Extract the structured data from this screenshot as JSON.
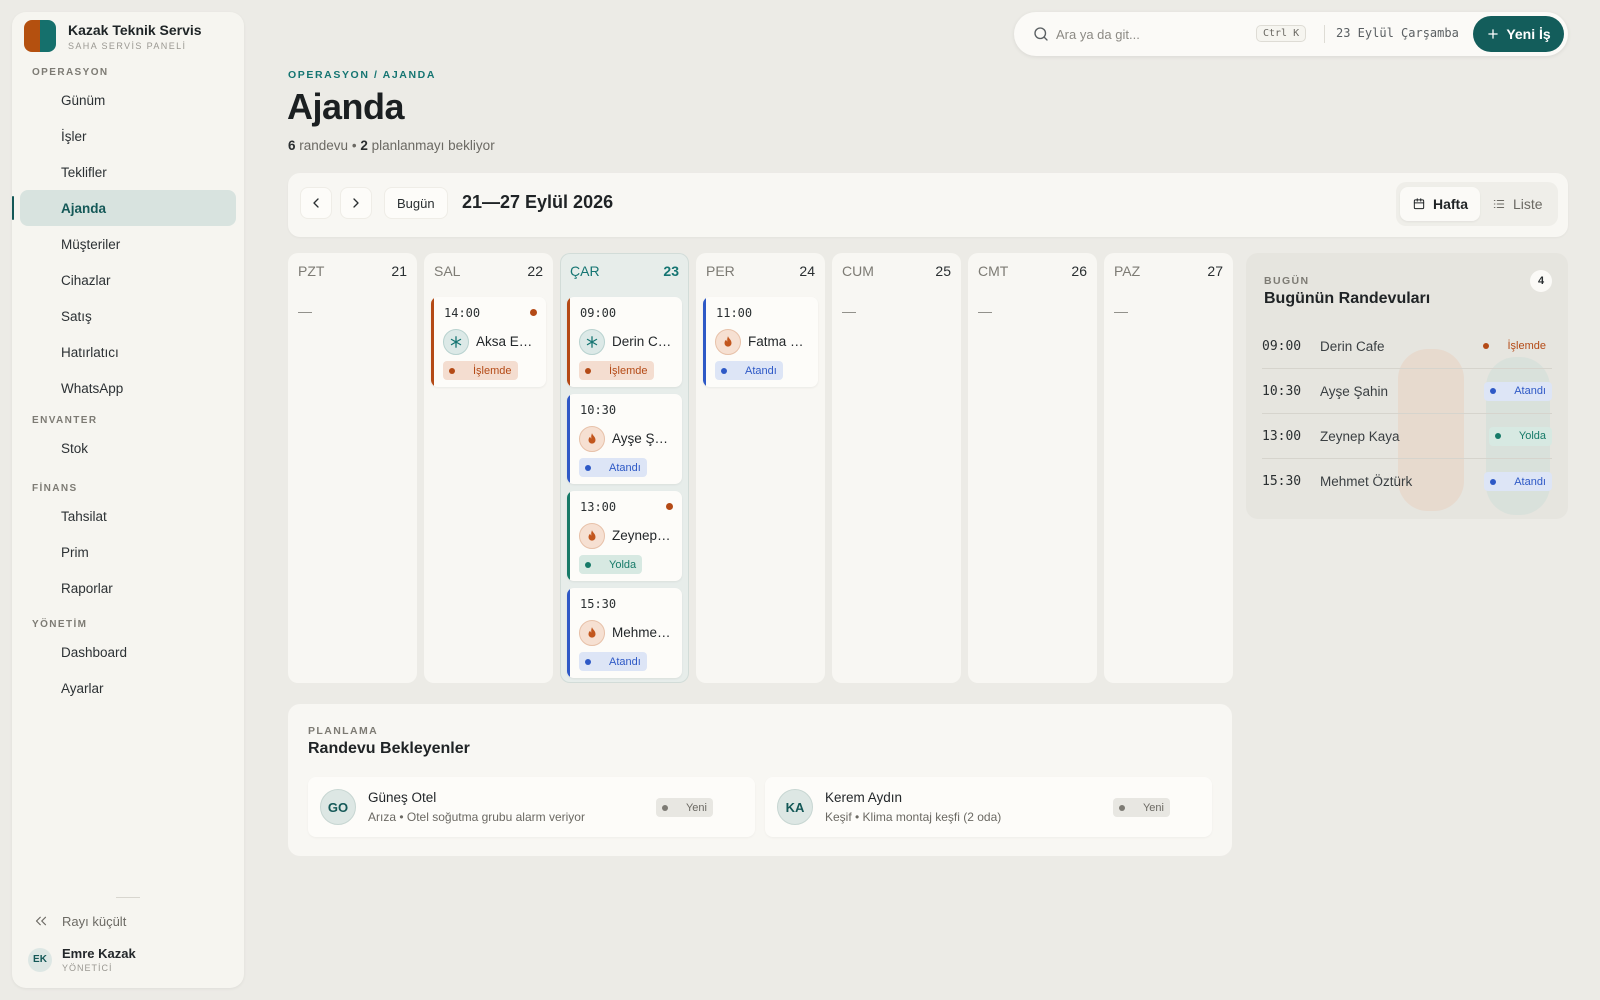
{
  "brand": {
    "name": "Kazak Teknik Servis",
    "subtitle": "SAHA SERVİS PANELİ",
    "colors": [
      "#b4500f",
      "#15706c"
    ]
  },
  "sidebar": {
    "groups": [
      {
        "title": "OPERASYON",
        "items": [
          {
            "label": "Günüm",
            "icon": "calendar-check-icon"
          },
          {
            "label": "İşler",
            "icon": "wrench-icon"
          },
          {
            "label": "Teklifler",
            "icon": "document-icon"
          },
          {
            "label": "Ajanda",
            "icon": "calendar-icon",
            "active": true
          },
          {
            "label": "Müşteriler",
            "icon": "users-icon"
          },
          {
            "label": "Cihazlar",
            "icon": "server-icon"
          },
          {
            "label": "Satış",
            "icon": "store-icon"
          },
          {
            "label": "Hatırlatıcı",
            "icon": "bell-icon"
          },
          {
            "label": "WhatsApp",
            "icon": "whatsapp-icon"
          }
        ]
      },
      {
        "title": "ENVANTER",
        "items": [
          {
            "label": "Stok",
            "icon": "box-icon"
          }
        ]
      },
      {
        "title": "FİNANS",
        "items": [
          {
            "label": "Tahsilat",
            "icon": "hand-coins-icon"
          },
          {
            "label": "Prim",
            "icon": "wallet-icon"
          },
          {
            "label": "Raporlar",
            "icon": "chart-line-icon"
          }
        ]
      },
      {
        "title": "YÖNETİM",
        "items": [
          {
            "label": "Dashboard",
            "icon": "bar-chart-icon"
          },
          {
            "label": "Ayarlar",
            "icon": "gear-icon"
          }
        ]
      }
    ],
    "collapse_label": "Rayı küçült",
    "user": {
      "initials": "EK",
      "name": "Emre Kazak",
      "role": "YÖNETİCİ"
    }
  },
  "topbar": {
    "search_placeholder": "Ara ya da git...",
    "shortcut": "Ctrl K",
    "date": "23 Eylül Çarşamba",
    "new_button": "Yeni İş"
  },
  "header": {
    "breadcrumb": "OPERASYON / AJANDA",
    "title": "Ajanda",
    "summary_count": "6",
    "summary_count_label": "randevu",
    "summary_sep": "•",
    "pending_count": "2",
    "pending_label": "planlanmayı bekliyor"
  },
  "toolbar": {
    "today_label": "Bugün",
    "range": "21—27 Eylül 2026",
    "views": {
      "week": "Hafta",
      "list": "Liste"
    }
  },
  "calendar": {
    "empty_mark": "—",
    "days": [
      {
        "name": "PZT",
        "num": "21",
        "appointments": []
      },
      {
        "name": "SAL",
        "num": "22",
        "appointments": [
          {
            "time": "14:00",
            "name": "Aksa Eczanesi",
            "service": "cool",
            "status": "islemde",
            "status_label": "İşlemde",
            "flag": true
          }
        ]
      },
      {
        "name": "ÇAR",
        "num": "23",
        "today": true,
        "appointments": [
          {
            "time": "09:00",
            "name": "Derin Cafe",
            "service": "cool",
            "status": "islemde",
            "status_label": "İşlemde",
            "flag": false
          },
          {
            "time": "10:30",
            "name": "Ayşe Şahin",
            "service": "heat",
            "status": "atandi",
            "status_label": "Atandı",
            "flag": false
          },
          {
            "time": "13:00",
            "name": "Zeynep Kaya",
            "service": "heat",
            "status": "yolda",
            "status_label": "Yolda",
            "flag": true
          },
          {
            "time": "15:30",
            "name": "Mehmet Öztürk",
            "service": "heat",
            "status": "atandi",
            "status_label": "Atandı",
            "flag": false
          }
        ]
      },
      {
        "name": "PER",
        "num": "24",
        "appointments": [
          {
            "time": "11:00",
            "name": "Fatma Demir",
            "service": "heat",
            "status": "atandi",
            "status_label": "Atandı",
            "flag": false
          }
        ]
      },
      {
        "name": "CUM",
        "num": "25",
        "appointments": []
      },
      {
        "name": "CMT",
        "num": "26",
        "appointments": []
      },
      {
        "name": "PAZ",
        "num": "27",
        "appointments": []
      }
    ]
  },
  "today_panel": {
    "eyebrow": "BUGÜN",
    "title": "Bugünün Randevuları",
    "count": "4",
    "rows": [
      {
        "time": "09:00",
        "name": "Derin Cafe",
        "status": "islemde",
        "status_label": "İşlemde"
      },
      {
        "time": "10:30",
        "name": "Ayşe Şahin",
        "status": "atandi",
        "status_label": "Atandı"
      },
      {
        "time": "13:00",
        "name": "Zeynep Kaya",
        "status": "yolda",
        "status_label": "Yolda"
      },
      {
        "time": "15:30",
        "name": "Mehmet Öztürk",
        "status": "atandi",
        "status_label": "Atandı"
      }
    ]
  },
  "planning": {
    "eyebrow": "PLANLAMA",
    "title": "Randevu Bekleyenler",
    "items": [
      {
        "initials": "GO",
        "name": "Güneş Otel",
        "desc": "Arıza • Otel soğutma grubu alarm veriyor",
        "badge": "Yeni"
      },
      {
        "initials": "KA",
        "name": "Kerem Aydın",
        "desc": "Keşif • Klima montaj keşfi (2 oda)",
        "badge": "Yeni"
      }
    ]
  },
  "colors": {
    "accent": "#135d5b",
    "islemde": "#b44a16",
    "atandi": "#2e59c6",
    "yolda": "#167a68"
  }
}
